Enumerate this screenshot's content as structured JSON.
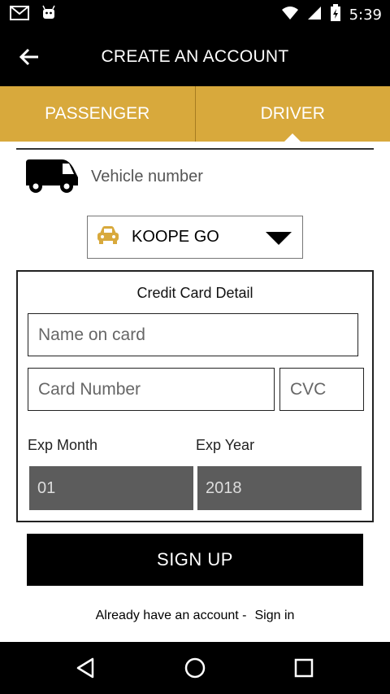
{
  "status_bar": {
    "time": "5:39"
  },
  "app_bar": {
    "title": "CREATE AN ACCOUNT"
  },
  "tabs": [
    {
      "label": "PASSENGER",
      "selected": false
    },
    {
      "label": "DRIVER",
      "selected": true
    }
  ],
  "vehicle": {
    "placeholder": "Vehicle number",
    "icon": "van-icon"
  },
  "vehicle_type": {
    "selected": "KOOPE GO",
    "icon": "car-icon",
    "icon_color": "#d8a93c"
  },
  "card": {
    "heading": "Credit Card Detail",
    "name_placeholder": "Name on card",
    "number_placeholder": "Card Number",
    "cvc_placeholder": "CVC",
    "exp_month_label": "Exp Month",
    "exp_year_label": "Exp Year",
    "exp_month_value": "01",
    "exp_year_value": "2018"
  },
  "signup_label": "SIGN UP",
  "footer": {
    "text": "Already have an account -",
    "link": "Sign in"
  },
  "colors": {
    "accent": "#d8a93c",
    "bar": "#000000",
    "select_bg": "#5c5c5c"
  }
}
